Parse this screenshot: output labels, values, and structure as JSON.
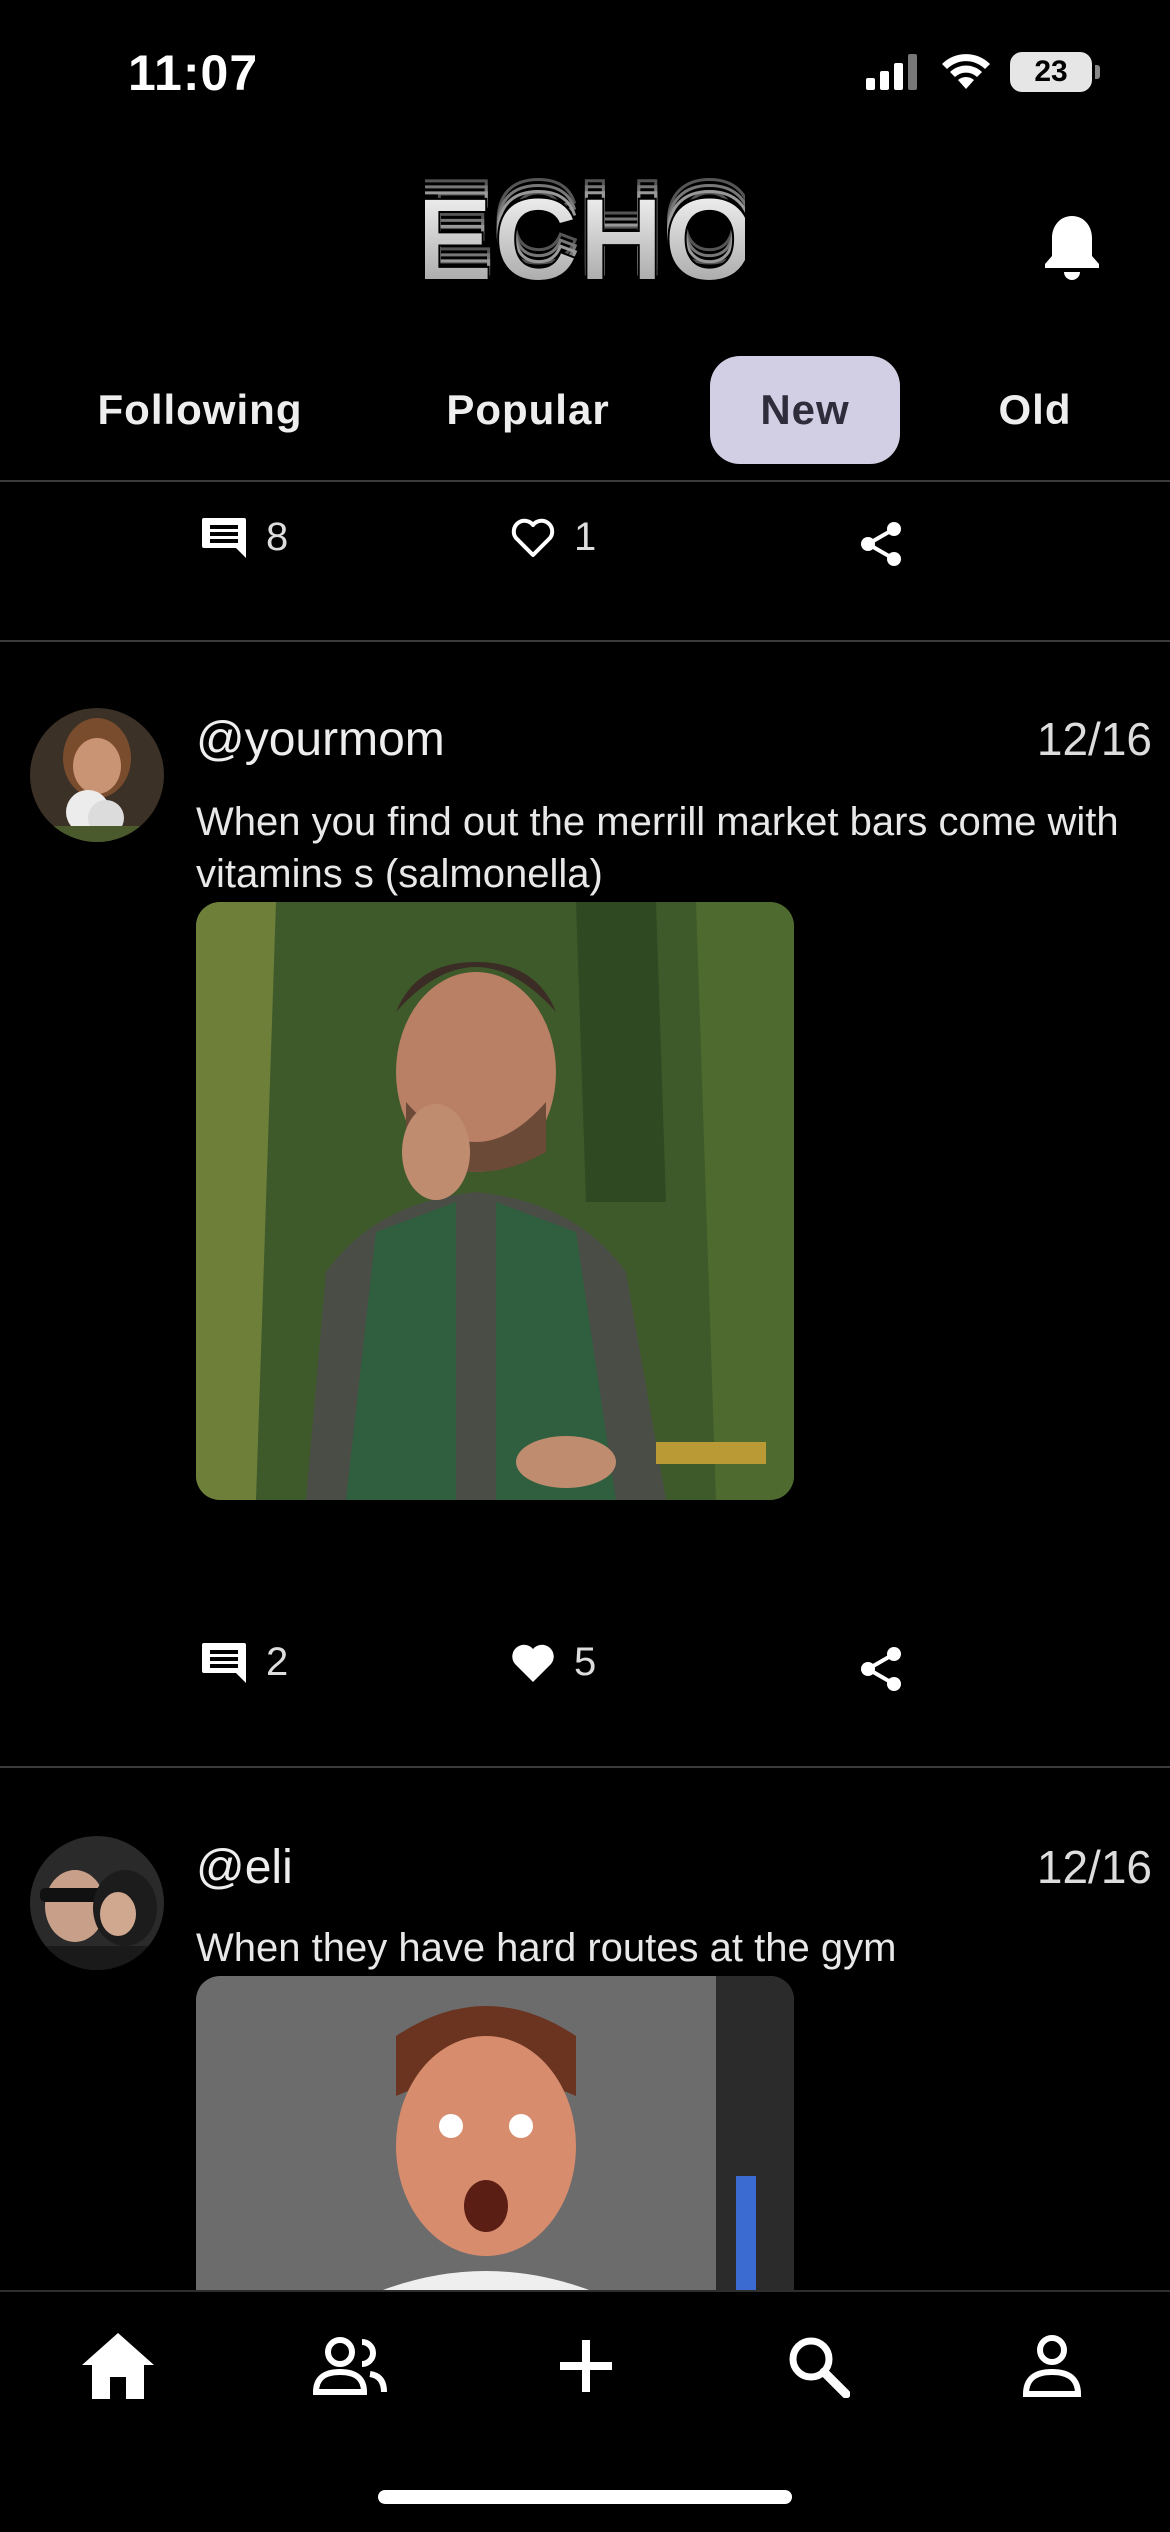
{
  "status_bar": {
    "time": "11:07",
    "battery": "23"
  },
  "app": {
    "logo_text": "ECHO"
  },
  "tabs": [
    {
      "label": "Following",
      "active": false
    },
    {
      "label": "Popular",
      "active": false
    },
    {
      "label": "New",
      "active": true
    },
    {
      "label": "Old",
      "active": false
    }
  ],
  "previous_post": {
    "comments": "8",
    "likes": "1"
  },
  "posts": [
    {
      "handle": "@yourmom",
      "date": "12/16",
      "text": "When you find out the merrill market bars come with vitamins s (salmonella)",
      "comments": "2",
      "likes": "5",
      "liked": true
    },
    {
      "handle": "@eli",
      "date": "12/16",
      "text": "When they have hard routes at the gym"
    }
  ],
  "bottom_nav": [
    "home-icon",
    "people-icon",
    "add-icon",
    "search-icon",
    "profile-icon"
  ],
  "colors": {
    "background": "#000000",
    "tab_active_bg": "#d2cee3",
    "text": "#ffffff"
  }
}
